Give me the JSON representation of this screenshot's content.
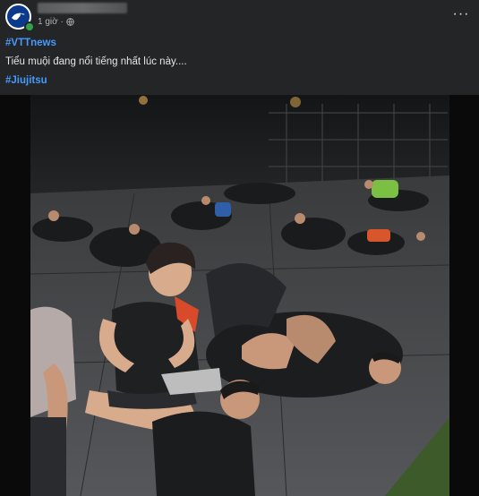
{
  "post": {
    "time": "1 giờ ·",
    "hashtag_1": "#VTTnews",
    "caption": "Tiểu muội đang nổi tiếng nhất lúc này....",
    "hashtag_2": "#Jiujitsu",
    "more_label": "···"
  },
  "icons": {
    "avatar": "page-logo-icon",
    "privacy": "globe-icon",
    "more": "more-options-icon"
  },
  "colors": {
    "background": "#242526",
    "hashtag": "#4599ff",
    "text": "#e4e6eb",
    "meta": "#b0b3b8"
  }
}
